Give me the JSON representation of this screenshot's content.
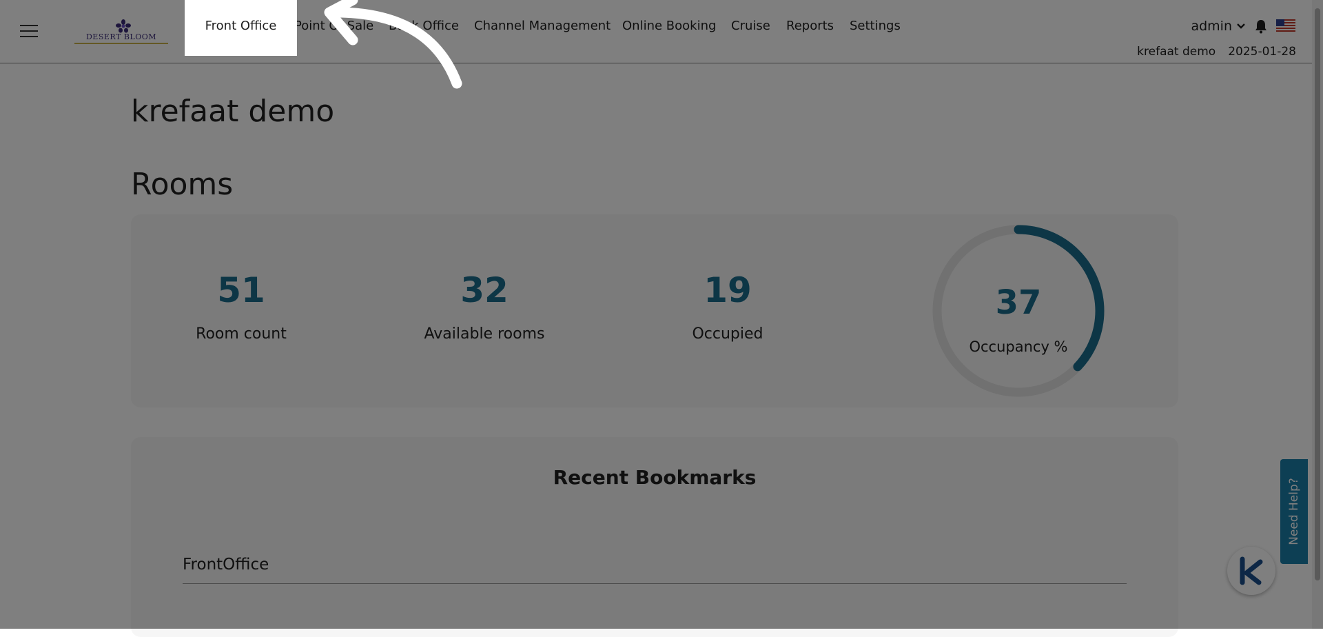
{
  "header": {
    "logo_text": "DESERT BLOOM",
    "nav": [
      {
        "label": "Front Office"
      },
      {
        "label": "Point Of Sale"
      },
      {
        "label": "Back Office"
      },
      {
        "label": "Channel Management"
      },
      {
        "label": "Online Booking"
      },
      {
        "label": "Cruise"
      },
      {
        "label": "Reports"
      },
      {
        "label": "Settings"
      }
    ],
    "user": "admin",
    "property": "krefaat demo",
    "date": "2025-01-28"
  },
  "main": {
    "title": "krefaat demo",
    "rooms_title": "Rooms",
    "stats": [
      {
        "value": "51",
        "label": "Room count"
      },
      {
        "value": "32",
        "label": "Available rooms"
      },
      {
        "value": "19",
        "label": "Occupied"
      }
    ],
    "occupancy": {
      "value": "37",
      "label": "Occupancy %",
      "fraction": 0.37
    },
    "bookmarks": {
      "title": "Recent Bookmarks",
      "items": [
        "FrontOffice"
      ]
    }
  },
  "help": {
    "label": "Need Help?"
  },
  "colors": {
    "accent": "#1a6c8c",
    "help_tab": "#1a7fa8",
    "chat_logo": "#1a4f8c"
  }
}
